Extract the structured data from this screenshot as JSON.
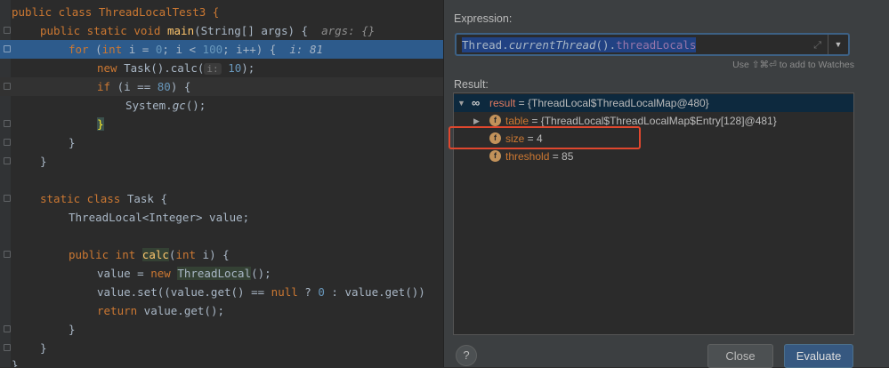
{
  "editor": {
    "lines": {
      "l1": "public class ThreadLocalTest3 {",
      "l2a": "public static void ",
      "l2b": "main",
      "l2c": "(String[] args) {",
      "l2hint": "args: {}",
      "l3a": "for",
      "l3b": " (",
      "l3c": "int",
      "l3d": " i = ",
      "l3e": "0",
      "l3f": "; i < ",
      "l3g": "100",
      "l3h": "; i++) {",
      "l3hint": "i: 81",
      "l4a": "new",
      "l4b": " Task().calc(",
      "l4hint": "i:",
      "l4c": "10",
      "l4d": ");",
      "l5a": "if",
      "l5b": " (i == ",
      "l5c": "80",
      "l5d": ") {",
      "l6a": "System.",
      "l6b": "gc",
      "l6c": "();",
      "l7": "}",
      "l8": "}",
      "l9": "}",
      "l11a": "static class",
      "l11b": " Task {",
      "l12": "ThreadLocal<Integer> value;",
      "l14a": "public int ",
      "l14b": "calc",
      "l14c": "(",
      "l14d": "int",
      "l14e": " i) {",
      "l15a": "value = ",
      "l15b": "new",
      "l15c": " ",
      "l15d": "ThreadLocal",
      "l15e": "();",
      "l16a": "value.set((value.get() == ",
      "l16b": "null",
      "l16c": " ? ",
      "l16d": "0",
      "l16e": " : value.get())",
      "l17a": "return",
      "l17b": " value.get();",
      "l18": "}",
      "l19": "}",
      "l20": "}"
    }
  },
  "dialog": {
    "expression_label": "Expression:",
    "expression_parts": {
      "p1": "Thread.",
      "p2": "currentThread",
      "p3": "().",
      "p4": "threadLocals"
    },
    "watch_hint": "Use ⇧⌘⏎ to add to Watches",
    "result_label": "Result:",
    "tree": {
      "root_name": "result",
      "root_value": " = {ThreadLocal$ThreadLocalMap@480}",
      "table_name": "table",
      "table_value": " = {ThreadLocal$ThreadLocalMap$Entry[128]@481}",
      "size_name": "size",
      "size_value": " = 4",
      "threshold_name": "threshold",
      "threshold_value": " = 85"
    },
    "help_label": "?",
    "close_label": "Close",
    "evaluate_label": "Evaluate"
  },
  "colors": {
    "exec_line": "#2d5b8c",
    "highlight_box": "#e0472e",
    "evaluate_button": "#365880"
  }
}
